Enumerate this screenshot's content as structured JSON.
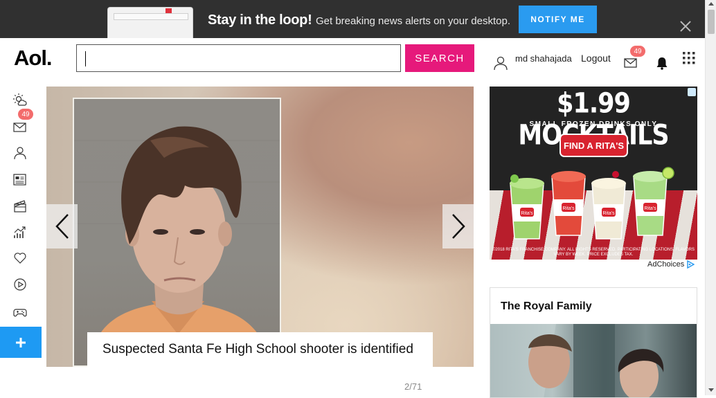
{
  "banner": {
    "title": "Stay in the loop!",
    "subtitle": "Get breaking news alerts on your desktop.",
    "notify_label": "NOTIFY ME"
  },
  "header": {
    "logo": "Aol.",
    "search_placeholder": "",
    "search_label": "SEARCH",
    "username": "md shahajada",
    "logout_label": "Logout",
    "mail_count": "49"
  },
  "sidebar": {
    "items": [
      {
        "icon": "weather-icon"
      },
      {
        "icon": "mail-icon",
        "badge": "49"
      },
      {
        "icon": "profile-icon"
      },
      {
        "icon": "news-icon"
      },
      {
        "icon": "entertainment-icon"
      },
      {
        "icon": "finance-icon"
      },
      {
        "icon": "lifestyle-icon"
      },
      {
        "icon": "video-icon"
      },
      {
        "icon": "games-icon"
      }
    ],
    "plus_label": "+"
  },
  "slideshow": {
    "caption": "Suspected Santa Fe High School shooter is identified",
    "counter": "2/71"
  },
  "ad": {
    "headline": "$1.99 MOCKTAILS",
    "subheadline": "SMALL FROZEN DRINKS ONLY",
    "cta": "FIND A RITA'S",
    "fine_print": "©2018 RITA'S FRANCHISE COMPANY. ALL RIGHTS RESERVED. PARTICIPATING LOCATIONS. FLAVORS VARY BY WEEK. PRICE EXCLUDES TAX.",
    "cup_label": "Rita's",
    "adchoices": "AdChoices"
  },
  "card": {
    "title": "The Royal Family"
  },
  "colors": {
    "accent_pink": "#e6197b",
    "accent_blue": "#2a9bf0",
    "badge_red": "#f36c6c",
    "banner_bg": "#303030"
  }
}
